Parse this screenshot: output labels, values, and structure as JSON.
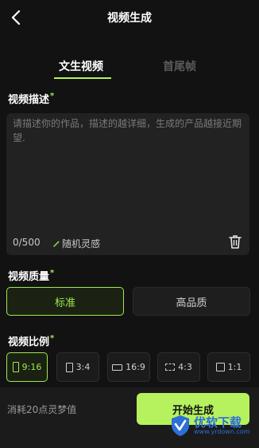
{
  "header": {
    "title": "视频生成"
  },
  "tabs": [
    {
      "label": "文生视频"
    },
    {
      "label": "首尾帧"
    }
  ],
  "description": {
    "label": "视频描述",
    "required_mark": "*",
    "placeholder": "请描述你的作品，描述的越详细，生成的产品越接近期望.",
    "counter": "0/500",
    "random_label": "随机灵感"
  },
  "quality": {
    "label": "视频质量",
    "required_mark": "*",
    "options": [
      {
        "label": "标准",
        "selected": true
      },
      {
        "label": "高品质",
        "selected": false
      }
    ]
  },
  "ratio": {
    "label": "视频比例",
    "required_mark": "*",
    "options": [
      {
        "label": "9:16",
        "selected": true
      },
      {
        "label": "3:4",
        "selected": false
      },
      {
        "label": "16:9",
        "selected": false
      },
      {
        "label": "4:3",
        "selected": false
      },
      {
        "label": "1:1",
        "selected": false
      }
    ]
  },
  "footer": {
    "cost_text": "消耗20点灵梦值",
    "start_label": "开始生成"
  },
  "watermark": {
    "name": "优软下载",
    "url": "www.yrdown.com"
  },
  "colors": {
    "accent": "#b6f25e",
    "background": "#121212",
    "panel": "#222222"
  }
}
